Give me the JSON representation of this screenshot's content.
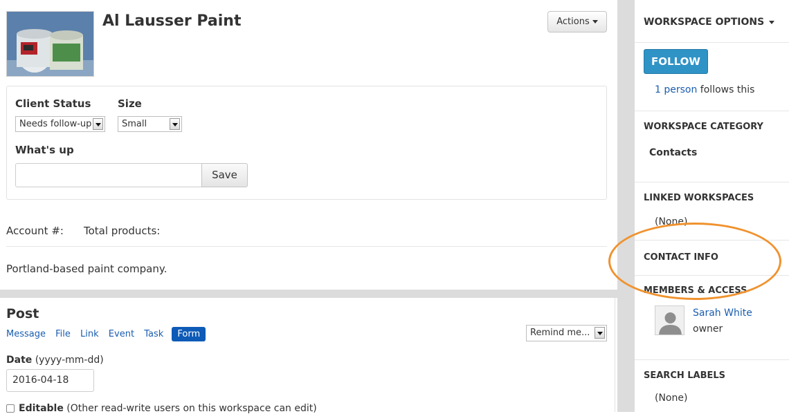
{
  "workspace": {
    "title": "Al Lausser Paint",
    "actions_label": "Actions"
  },
  "status_form": {
    "client_status_label": "Client Status",
    "client_status_value": "Needs follow-up",
    "size_label": "Size",
    "size_value": "Small",
    "whats_up_label": "What's up",
    "whats_up_value": "",
    "save_label": "Save"
  },
  "details": {
    "account_label": "Account #:",
    "total_products_label": "Total products:",
    "description": "Portland-based paint company."
  },
  "post": {
    "title": "Post",
    "tabs": [
      "Message",
      "File",
      "Link",
      "Event",
      "Task",
      "Form"
    ],
    "active_tab": "Form",
    "remind_label": "Remind me...",
    "date_label": "Date",
    "date_format": "(yyyy-mm-dd)",
    "date_value": "2016-04-18",
    "editable_label": "Editable",
    "editable_note": "(Other read-write users on this workspace can edit)"
  },
  "sidebar": {
    "options_label": "WORKSPACE OPTIONS",
    "follow_label": "FOLLOW",
    "followers_link": "1 person",
    "followers_suffix": " follows this",
    "category_heading": "WORKSPACE CATEGORY",
    "category_value": "Contacts",
    "linked_heading": "LINKED WORKSPACES",
    "linked_value": "(None)",
    "contact_heading": "CONTACT INFO",
    "members_heading": "MEMBERS & ACCESS",
    "member_name": "Sarah White",
    "member_role": "owner",
    "labels_heading": "SEARCH LABELS",
    "labels_value": "(None)"
  },
  "colors": {
    "link": "#1a5db0",
    "follow_button": "#2f93c6",
    "active_tab": "#0d5ab7",
    "highlight_ellipse": "#f0922e",
    "gutter": "#dcdcdc"
  }
}
